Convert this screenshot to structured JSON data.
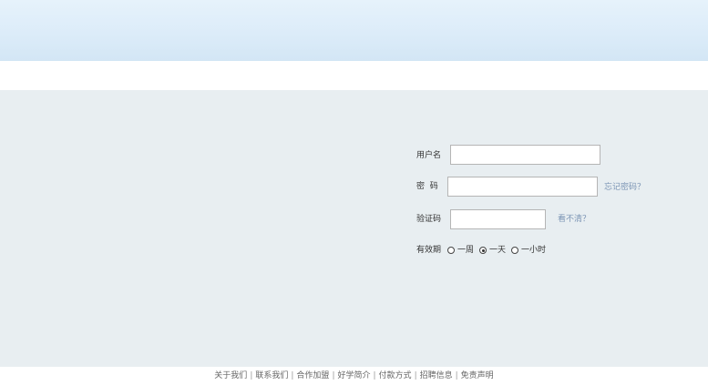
{
  "login": {
    "username_label": "用户名",
    "password_label": "密  码",
    "forgot_password": "忘记密码？",
    "captcha_label": "验证码",
    "captcha_refresh": "看不清？",
    "validity_label": "有效期",
    "validity_options": [
      {
        "label": "一周",
        "checked": false
      },
      {
        "label": "一天",
        "checked": true
      },
      {
        "label": "一小时",
        "checked": false
      }
    ]
  },
  "footer": {
    "links": [
      "关于我们",
      "联系我们",
      "合作加盟",
      "好学简介",
      "付款方式",
      "招聘信息",
      "免责声明"
    ],
    "separator": "|"
  }
}
